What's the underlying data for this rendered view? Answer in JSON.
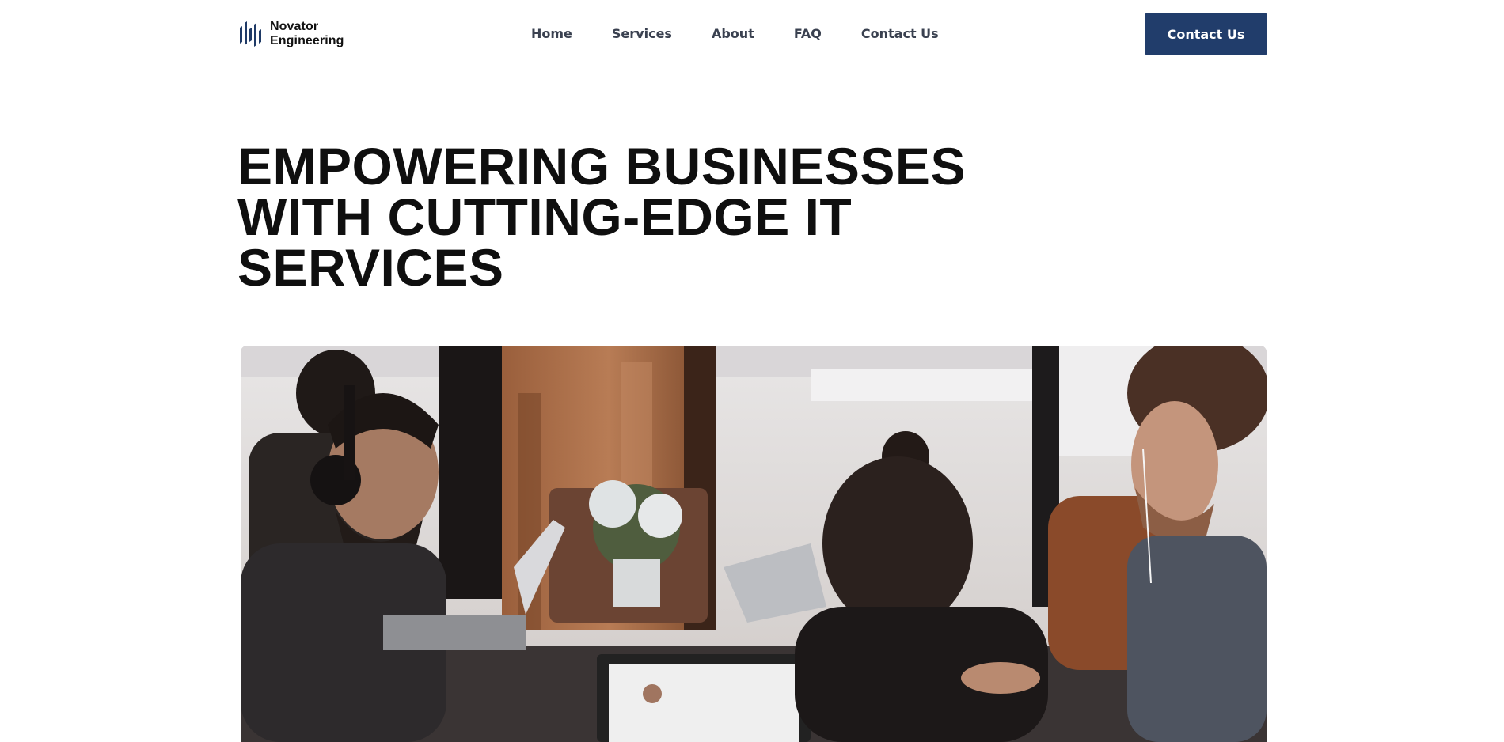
{
  "brand": {
    "name_line1": "Novator",
    "name_line2": "Engineering",
    "logo_icon": "bars-logo-icon",
    "accent_color": "#213d6b"
  },
  "nav": {
    "items": [
      {
        "label": "Home"
      },
      {
        "label": "Services"
      },
      {
        "label": "About"
      },
      {
        "label": "FAQ"
      },
      {
        "label": "Contact Us"
      }
    ]
  },
  "header": {
    "cta_label": "Contact Us"
  },
  "hero": {
    "title_line1": "EMPOWERING BUSINESSES",
    "title_line2": "WITH CUTTING-EDGE IT",
    "title_line3": "SERVICES",
    "image_subject": "team-working-on-laptops-photo"
  }
}
